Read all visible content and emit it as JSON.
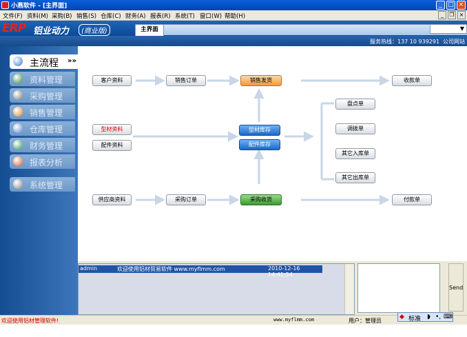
{
  "window": {
    "title": "小燕软件 - [主界面]",
    "min_label": "_",
    "max_label": "□",
    "close_label": "×"
  },
  "menu": {
    "items": [
      "文件(F)",
      "资料(M)",
      "采购(B)",
      "销售(S)",
      "仓库(C)",
      "财务(A)",
      "报表(R)",
      "系统(T)",
      "窗口(W)",
      "帮助(H)"
    ],
    "mdi_buttons": [
      "_",
      "❐",
      "×"
    ]
  },
  "brand": {
    "logo": "ERP",
    "name": "铝业动力",
    "edition": "(商业版)"
  },
  "tabs": {
    "active": "主界面"
  },
  "hotline": {
    "phone": "服务热线：137 10 939291",
    "site": "公司网站"
  },
  "sidebar": {
    "items": [
      {
        "label": "主流程",
        "active": true,
        "arrows": "»»",
        "icon": "globe-icon",
        "color": "#2a7bd0"
      },
      {
        "label": "资料管理",
        "active": false,
        "icon": "document-icon",
        "color": "#3a8a3a"
      },
      {
        "label": "采购管理",
        "active": false,
        "icon": "basket-icon",
        "color": "#7a7a7a"
      },
      {
        "label": "销售管理",
        "active": false,
        "icon": "sales-icon",
        "color": "#d88a2a"
      },
      {
        "label": "仓库管理",
        "active": false,
        "icon": "warehouse-icon",
        "color": "#5c8ad0"
      },
      {
        "label": "财务管理",
        "active": false,
        "icon": "money-icon",
        "color": "#2c9a5a"
      },
      {
        "label": "报表分析",
        "active": false,
        "icon": "chart-icon",
        "color": "#e05a2a"
      },
      {
        "label": "系统管理",
        "active": false,
        "icon": "tools-icon",
        "color": "#8a8a8a"
      }
    ]
  },
  "flow": {
    "customer": "客户资料",
    "sales_order": "销售订单",
    "sales_ship": "销售发货",
    "receipt": "收款单",
    "profile_data": "型材资料",
    "parts_data": "配件资料",
    "profile_stock": "型材库存",
    "parts_stock": "配件库存",
    "stocktake": "盘点单",
    "transfer": "调拨单",
    "other_in": "其它入库单",
    "other_out": "其它出库单",
    "supplier": "供应商资料",
    "purchase_order": "采购订单",
    "purchase_receive": "采购收货",
    "payment": "付款单"
  },
  "messages": {
    "rows": [
      {
        "user": "admin",
        "text": "欢迎使用铝材贸易软件 www.myflmm.com",
        "time": "2010-12-16 14:41:54"
      }
    ],
    "send_label": "Send"
  },
  "ime": {
    "mode": "标准"
  },
  "status": {
    "welcome": "欢迎使用铝材管理软件!",
    "url": "www.myflmm.com",
    "user": "用户：管理员"
  }
}
